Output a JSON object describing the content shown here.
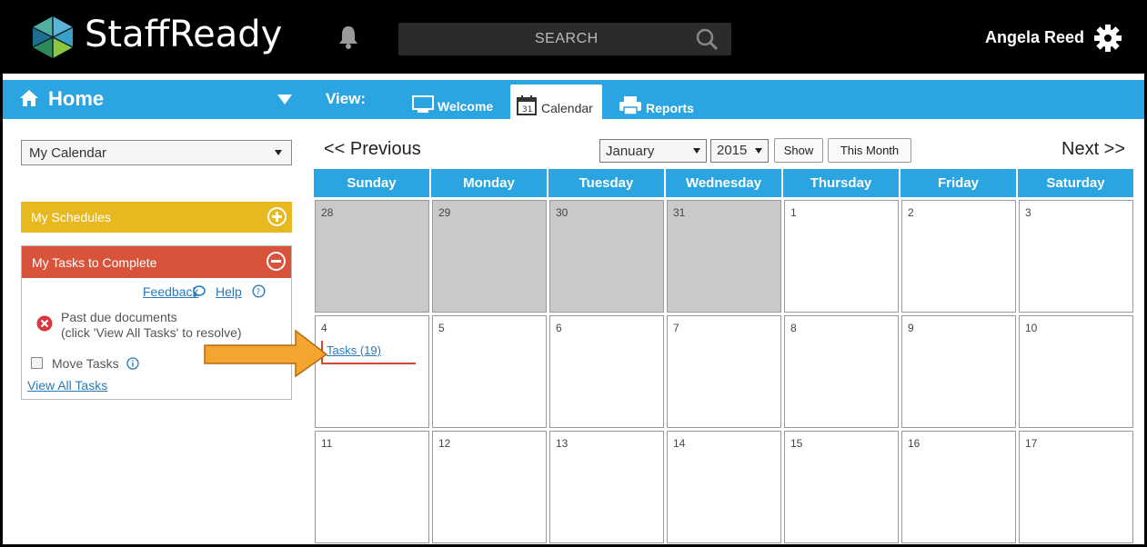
{
  "app": {
    "brand": "StaffReady",
    "search_placeholder": "SEARCH",
    "user_name": "Angela Reed",
    "colors": {
      "topbar": "#000000",
      "nav": "#2aa5e1",
      "schedules": "#e8b820",
      "tasks": "#d9533a",
      "link": "#2a7ab8"
    }
  },
  "nav": {
    "home_label": "Home",
    "view_label": "View:",
    "tabs": [
      {
        "label": "Welcome",
        "icon": "monitor-icon",
        "active": false
      },
      {
        "label": "Calendar",
        "icon": "calendar-icon",
        "active": true
      },
      {
        "label": "Reports",
        "icon": "printer-icon",
        "active": false
      }
    ]
  },
  "sidebar": {
    "calendar_select": "My Calendar",
    "schedules_title": "My Schedules",
    "tasks_title": "My Tasks to Complete",
    "feedback_label": "Feedback",
    "help_label": "Help",
    "past_due_line1": "Past due documents",
    "past_due_line2": "(click 'View All Tasks' to resolve)",
    "move_tasks_label": "Move Tasks",
    "view_all_label": "View All Tasks"
  },
  "calendar": {
    "prev_label": "<< Previous",
    "next_label": "Next >>",
    "month": "January",
    "year": "2015",
    "show_label": "Show",
    "this_month_label": "This Month",
    "days": [
      "Sunday",
      "Monday",
      "Tuesday",
      "Wednesday",
      "Thursday",
      "Friday",
      "Saturday"
    ],
    "weeks": [
      [
        {
          "d": "28",
          "other": true
        },
        {
          "d": "29",
          "other": true
        },
        {
          "d": "30",
          "other": true
        },
        {
          "d": "31",
          "other": true
        },
        {
          "d": "1",
          "other": false
        },
        {
          "d": "2",
          "other": false
        },
        {
          "d": "3",
          "other": false
        }
      ],
      [
        {
          "d": "4",
          "other": false
        },
        {
          "d": "5",
          "other": false
        },
        {
          "d": "6",
          "other": false
        },
        {
          "d": "7",
          "other": false
        },
        {
          "d": "8",
          "other": false
        },
        {
          "d": "9",
          "other": false
        },
        {
          "d": "10",
          "other": false
        }
      ],
      [
        {
          "d": "11",
          "other": false
        },
        {
          "d": "12",
          "other": false
        },
        {
          "d": "13",
          "other": false
        },
        {
          "d": "14",
          "other": false
        },
        {
          "d": "15",
          "other": false
        },
        {
          "d": "16",
          "other": false
        },
        {
          "d": "17",
          "other": false
        }
      ]
    ],
    "tasks_link": "Tasks (19)"
  }
}
